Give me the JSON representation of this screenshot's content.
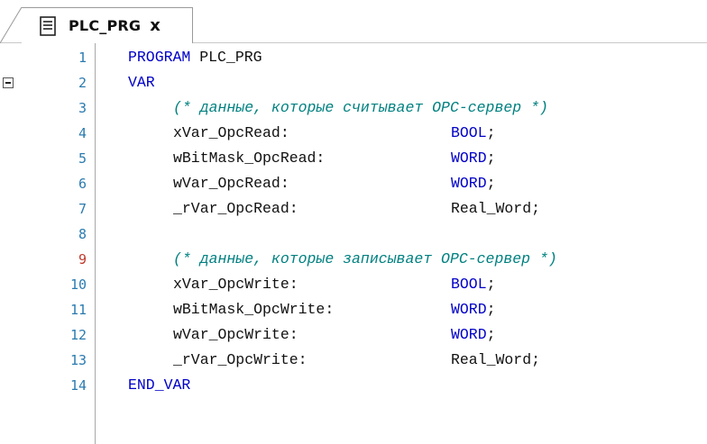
{
  "tab": {
    "title": "PLC_PRG",
    "close": "x",
    "icon": "document-icon"
  },
  "editor": {
    "lines": [
      {
        "num": "1",
        "indent": 0,
        "kind": "stmt",
        "kw": "PROGRAM",
        "rest": " PLC_PRG"
      },
      {
        "num": "2",
        "indent": 0,
        "kind": "kw",
        "text": "VAR",
        "fold": true
      },
      {
        "num": "3",
        "indent": 1,
        "kind": "comment",
        "text": "(* данные, которые считывает OPC-сервер *)"
      },
      {
        "num": "4",
        "indent": 1,
        "kind": "decl",
        "name": "xVar_OpcRead:",
        "type": "BOOL",
        "end": ";"
      },
      {
        "num": "5",
        "indent": 1,
        "kind": "decl",
        "name": "wBitMask_OpcRead:",
        "type": "WORD",
        "end": ";"
      },
      {
        "num": "6",
        "indent": 1,
        "kind": "decl",
        "name": "wVar_OpcRead:",
        "type": "WORD",
        "end": ";"
      },
      {
        "num": "7",
        "indent": 1,
        "kind": "decl",
        "name": "_rVar_OpcRead:",
        "type": "Real_Word",
        "end": ";",
        "plainType": true
      },
      {
        "num": "8",
        "indent": 0,
        "kind": "blank"
      },
      {
        "num": "9",
        "indent": 1,
        "kind": "comment",
        "text": "(* данные, которые записывает OPC-сервер *)",
        "modified": true
      },
      {
        "num": "10",
        "indent": 1,
        "kind": "decl",
        "name": "xVar_OpcWrite:",
        "type": "BOOL",
        "end": ";"
      },
      {
        "num": "11",
        "indent": 1,
        "kind": "decl",
        "name": "wBitMask_OpcWrite:",
        "type": "WORD",
        "end": ";"
      },
      {
        "num": "12",
        "indent": 1,
        "kind": "decl",
        "name": "wVar_OpcWrite:",
        "type": "WORD",
        "end": ";"
      },
      {
        "num": "13",
        "indent": 1,
        "kind": "decl",
        "name": "_rVar_OpcWrite:",
        "type": "Real_Word",
        "end": ";",
        "plainType": true
      },
      {
        "num": "14",
        "indent": 0,
        "kind": "kw",
        "text": "END_VAR"
      }
    ]
  },
  "colors": {
    "keyword": "#0000c8",
    "comment": "#008080",
    "line_number": "#2b7bb0",
    "line_number_modified": "#c0392b"
  }
}
